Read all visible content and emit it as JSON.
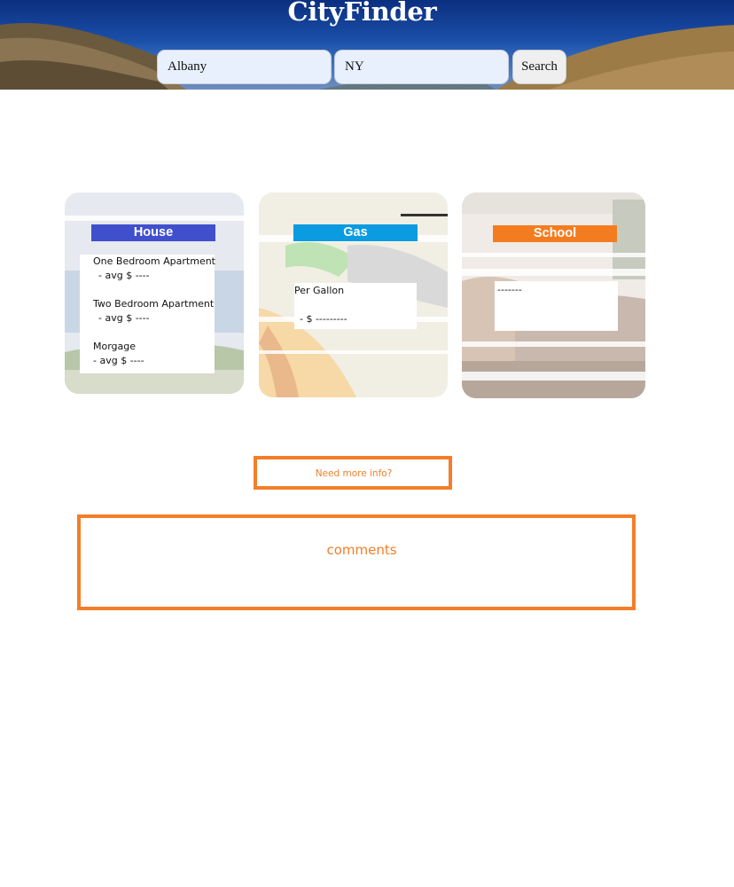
{
  "header": {
    "title": "CityFinder",
    "city_value": "Albany",
    "state_value": "NY",
    "search_label": "Search"
  },
  "cards": {
    "house": {
      "title": "House",
      "items": [
        {
          "label": "One Bedroom Apartment",
          "value": " -  avg $ ----"
        },
        {
          "label": "Two Bedroom Apartment",
          "value": " -  avg $ ----"
        },
        {
          "label": "Morgage",
          "value": "- avg $ ----"
        }
      ]
    },
    "gas": {
      "title": "Gas",
      "label": "Per Gallon",
      "value": "- $ ---------"
    },
    "school": {
      "title": "School",
      "value": "-------"
    }
  },
  "more_info_label": "Need more info?",
  "comments_label": "comments",
  "colors": {
    "accent_orange": "#f37e2a",
    "house_header": "#4050cc",
    "gas_header": "#0a9be0",
    "school_header": "#f47c20"
  }
}
